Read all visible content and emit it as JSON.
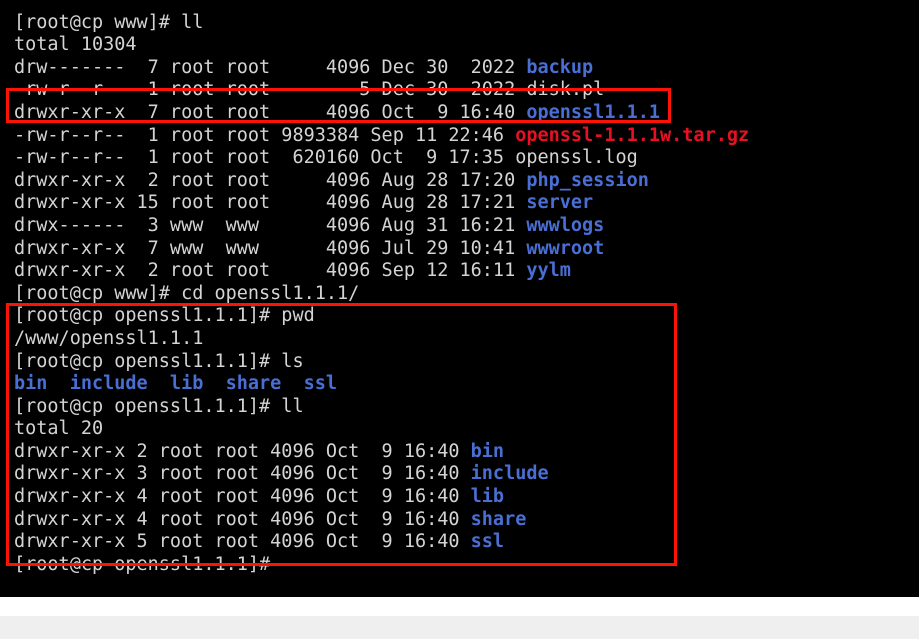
{
  "terminal": {
    "background_color": "#000000",
    "foreground_color": "#d4d4d4",
    "dir_color": "#4a6fd4",
    "archive_color": "#e81123",
    "highlight_color": "#fb1405",
    "lines": [
      {
        "id": "partial-top",
        "text": "",
        "class": "c-default"
      },
      {
        "id": "prompt-ll-1",
        "text": "[root@cp www]# ll",
        "class": "c-default"
      },
      {
        "id": "total-1",
        "text": "total 10304",
        "class": "c-default"
      },
      {
        "id": "row-backup",
        "text": "drw-------  7 root root     4096 Dec 30  2022 ",
        "class": "c-default",
        "name": "backup",
        "name_class": "c-dir"
      },
      {
        "id": "row-disk-pl",
        "text": "-rw-r--r--  1 root root        5 Dec 30  2022 ",
        "class": "c-default",
        "name": "disk.pl",
        "name_class": "c-file"
      },
      {
        "id": "row-openssl111",
        "text": "drwxr-xr-x  7 root root     4096 Oct  9 16:40 ",
        "class": "c-default",
        "name": "openssl1.1.1",
        "name_class": "c-dir"
      },
      {
        "id": "row-openssl-tgz",
        "text": "-rw-r--r--  1 root root 9893384 Sep 11 22:46 ",
        "class": "c-default",
        "name": "openssl-1.1.1w.tar.gz",
        "name_class": "c-arch"
      },
      {
        "id": "row-openssl-log",
        "text": "-rw-r--r--  1 root root  620160 Oct  9 17:35 ",
        "class": "c-default",
        "name": "openssl.log",
        "name_class": "c-file"
      },
      {
        "id": "row-php-session",
        "text": "drwxr-xr-x  2 root root     4096 Aug 28 17:20 ",
        "class": "c-default",
        "name": "php_session",
        "name_class": "c-dir"
      },
      {
        "id": "row-server",
        "text": "drwxr-xr-x 15 root root     4096 Aug 28 17:21 ",
        "class": "c-default",
        "name": "server",
        "name_class": "c-dir"
      },
      {
        "id": "row-wwwlogs",
        "text": "drwx------  3 www  www      4096 Aug 31 16:21 ",
        "class": "c-default",
        "name": "wwwlogs",
        "name_class": "c-dir"
      },
      {
        "id": "row-wwwroot",
        "text": "drwxr-xr-x  7 www  www      4096 Jul 29 10:41 ",
        "class": "c-default",
        "name": "wwwroot",
        "name_class": "c-dir"
      },
      {
        "id": "row-yylm",
        "text": "drwxr-xr-x  2 root root     4096 Sep 12 16:11 ",
        "class": "c-default",
        "name": "yylm",
        "name_class": "c-dir"
      },
      {
        "id": "prompt-cd",
        "text": "[root@cp www]# cd openssl1.1.1/",
        "class": "c-default"
      },
      {
        "id": "prompt-pwd",
        "text": "[root@cp openssl1.1.1]# pwd",
        "class": "c-default"
      },
      {
        "id": "pwd-output",
        "text": "/www/openssl1.1.1",
        "class": "c-default"
      },
      {
        "id": "prompt-ls",
        "text": "[root@cp openssl1.1.1]# ls",
        "class": "c-default"
      },
      {
        "id": "ls-output",
        "text": "bin  include  lib  share  ssl",
        "class": "c-dir"
      },
      {
        "id": "prompt-ll-2",
        "text": "[root@cp openssl1.1.1]# ll",
        "class": "c-default"
      },
      {
        "id": "total-2",
        "text": "total 20",
        "class": "c-default"
      },
      {
        "id": "row-bin",
        "text": "drwxr-xr-x 2 root root 4096 Oct  9 16:40 ",
        "class": "c-default",
        "name": "bin",
        "name_class": "c-dir"
      },
      {
        "id": "row-include",
        "text": "drwxr-xr-x 3 root root 4096 Oct  9 16:40 ",
        "class": "c-default",
        "name": "include",
        "name_class": "c-dir"
      },
      {
        "id": "row-lib",
        "text": "drwxr-xr-x 4 root root 4096 Oct  9 16:40 ",
        "class": "c-default",
        "name": "lib",
        "name_class": "c-dir"
      },
      {
        "id": "row-share",
        "text": "drwxr-xr-x 4 root root 4096 Oct  9 16:40 ",
        "class": "c-default",
        "name": "share",
        "name_class": "c-dir"
      },
      {
        "id": "row-ssl",
        "text": "drwxr-xr-x 5 root root 4096 Oct  9 16:40 ",
        "class": "c-default",
        "name": "ssl",
        "name_class": "c-dir"
      },
      {
        "id": "prompt-final",
        "text": "[root@cp openssl1.1.1]#",
        "class": "c-default"
      }
    ]
  },
  "annotations": {
    "boxes": [
      {
        "id": "hl-openssl-dir",
        "label": "openssl1.1.1 directory entry highlight"
      },
      {
        "id": "hl-openssl-session",
        "label": "openssl1.1.1 directory contents highlight"
      }
    ]
  }
}
